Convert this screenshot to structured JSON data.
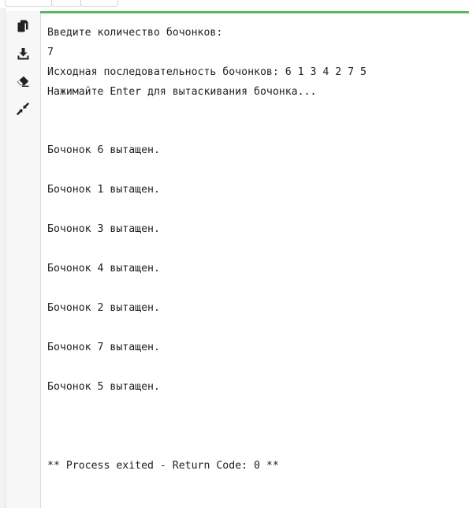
{
  "toolbar": {
    "icons": [
      "copy-icon",
      "download-icon",
      "eraser-icon",
      "collapse-icon"
    ]
  },
  "colors": {
    "accent_bar": "#5cb85c",
    "icon": "#222222",
    "text": "#222222"
  },
  "console": {
    "lines": [
      "Введите количество бочонков:",
      "7",
      "Исходная последовательность бочонков: 6 1 3 4 2 7 5",
      "Нажимайте Enter для вытаскивания бочонка...",
      "Бочонок 6 вытащен.",
      "Бочонок 1 вытащен.",
      "Бочонок 3 вытащен.",
      "Бочонок 4 вытащен.",
      "Бочонок 2 вытащен.",
      "Бочонок 7 вытащен.",
      "Бочонок 5 вытащен.",
      "** Process exited - Return Code: 0 **"
    ]
  }
}
